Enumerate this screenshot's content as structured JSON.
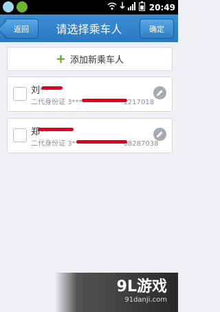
{
  "status_bar": {
    "time": "20:49",
    "icons": [
      "app-icon",
      "app-icon",
      "wifi-icon",
      "signal-icon",
      "download-icon",
      "battery-icon"
    ]
  },
  "header": {
    "back_label": "返回",
    "title": "请选择乘车人",
    "confirm_label": "确定"
  },
  "add_passenger": {
    "label": "添加新乘车人",
    "icon": "plus-icon",
    "icon_color": "#5fa31d"
  },
  "passengers": [
    {
      "name": "刘**",
      "id_type": "二代身份证",
      "id_number": "3***************1217018",
      "checked": false
    },
    {
      "name": "郑**",
      "id_type": "二代身份证",
      "id_number": "3***************08287038",
      "checked": false
    }
  ],
  "watermark": {
    "logo": "9L游戏",
    "url": "91danji.com"
  },
  "colors": {
    "header": "#2a78c2",
    "background": "#eef0f3",
    "redaction": "#e0001b"
  }
}
